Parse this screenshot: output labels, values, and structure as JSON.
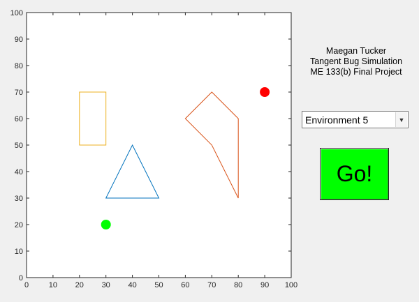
{
  "chart_data": {
    "type": "scatter",
    "title": "",
    "xlabel": "",
    "ylabel": "",
    "xlim": [
      0,
      100
    ],
    "ylim": [
      0,
      100
    ],
    "x_ticks": [
      0,
      10,
      20,
      30,
      40,
      50,
      60,
      70,
      80,
      90,
      100
    ],
    "y_ticks": [
      0,
      10,
      20,
      30,
      40,
      50,
      60,
      70,
      80,
      90,
      100
    ],
    "grid": false,
    "obstacles": [
      {
        "shape": "rectangle",
        "color": "#edb120",
        "points": [
          [
            20,
            50
          ],
          [
            30,
            50
          ],
          [
            30,
            70
          ],
          [
            20,
            70
          ]
        ]
      },
      {
        "shape": "triangle",
        "color": "#0072bd",
        "points": [
          [
            30,
            30
          ],
          [
            50,
            30
          ],
          [
            40,
            50
          ]
        ]
      },
      {
        "shape": "polygon",
        "color": "#d95319",
        "points": [
          [
            60,
            60
          ],
          [
            70,
            70
          ],
          [
            80,
            60
          ],
          [
            80,
            30
          ],
          [
            70,
            50
          ]
        ]
      }
    ],
    "start_point": {
      "x": 30,
      "y": 20,
      "color": "#00ff00"
    },
    "goal_point": {
      "x": 90,
      "y": 70,
      "color": "#ff0000"
    }
  },
  "info": {
    "author": "Maegan Tucker",
    "title": "Tangent Bug Simulation",
    "course": "ME 133(b) Final Project"
  },
  "environment_select": {
    "selected": "Environment 5",
    "arrow_icon": "chevron-down-icon"
  },
  "go_button": {
    "label": "Go!",
    "color": "#00ff00"
  }
}
